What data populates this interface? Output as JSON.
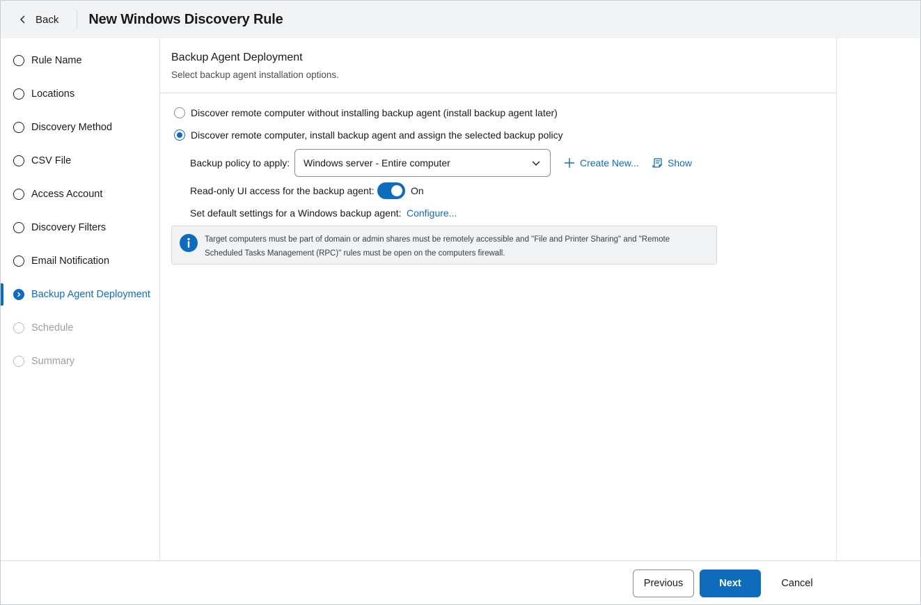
{
  "header": {
    "back_label": "Back",
    "title": "New Windows Discovery Rule"
  },
  "sidebar": {
    "steps": [
      {
        "label": "Rule Name",
        "state": "done"
      },
      {
        "label": "Locations",
        "state": "done"
      },
      {
        "label": "Discovery Method",
        "state": "done"
      },
      {
        "label": "CSV File",
        "state": "done"
      },
      {
        "label": "Access Account",
        "state": "done"
      },
      {
        "label": "Discovery Filters",
        "state": "done"
      },
      {
        "label": "Email Notification",
        "state": "done"
      },
      {
        "label": "Backup Agent Deployment",
        "state": "active"
      },
      {
        "label": "Schedule",
        "state": "disabled"
      },
      {
        "label": "Summary",
        "state": "disabled"
      }
    ]
  },
  "main": {
    "title": "Backup Agent Deployment",
    "subtitle": "Select backup agent installation options.",
    "options": [
      {
        "label": "Discover remote computer without installing backup agent (install backup agent later)",
        "checked": false
      },
      {
        "label": "Discover remote computer, install backup agent and assign the selected backup policy",
        "checked": true
      }
    ],
    "policy_label": "Backup policy to apply:",
    "policy_value": "Windows server - Entire computer",
    "create_new_label": "Create New...",
    "show_label": "Show",
    "readonly_label": "Read-only UI access for the backup agent:",
    "readonly_state": "On",
    "readonly_enabled": true,
    "defaults_label": "Set default settings for a Windows backup agent:",
    "configure_label": "Configure...",
    "info_text": "Target computers must be part of domain or admin shares must be remotely accessible and \"File and Printer Sharing\" and \"Remote Scheduled Tasks Management (RPC)\" rules must be open on the computers firewall."
  },
  "footer": {
    "previous_label": "Previous",
    "next_label": "Next",
    "cancel_label": "Cancel"
  },
  "colors": {
    "accent": "#0f6cbd",
    "header_bg": "#f2f3f4",
    "info_bg": "#f2f3f4"
  }
}
